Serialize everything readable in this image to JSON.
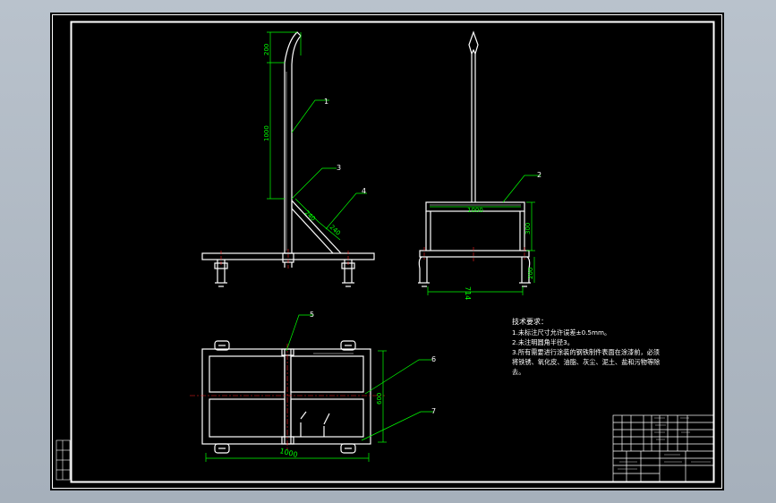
{
  "colors": {
    "background": "#a9b3be",
    "sheet": "#000000",
    "line": "#ffffff",
    "dimension": "#00ff00",
    "leader": "#00ff00",
    "centerline": "#ff2020"
  },
  "balloons": [
    "1",
    "2",
    "3",
    "4",
    "5",
    "6",
    "7"
  ],
  "dimensions": {
    "side_top": "200",
    "side_height": "1000",
    "brace_a": "240",
    "brace_b": "240",
    "front_width": "1000",
    "front_height": "300",
    "front_leg": "200",
    "front_base": "714",
    "plan_width": "1000",
    "plan_depth": "600"
  },
  "notes": {
    "title": "技术要求：",
    "lines": [
      "1.未标注尺寸允许误差±0.5mm。",
      "2.未注明圆角半径3。",
      "3.所有需要进行涂装的钢铁制件表面在涂漆前，必须",
      "将铁锈、氧化皮、油脂、灰尘、泥土、盐和污物等除",
      "去。"
    ]
  }
}
